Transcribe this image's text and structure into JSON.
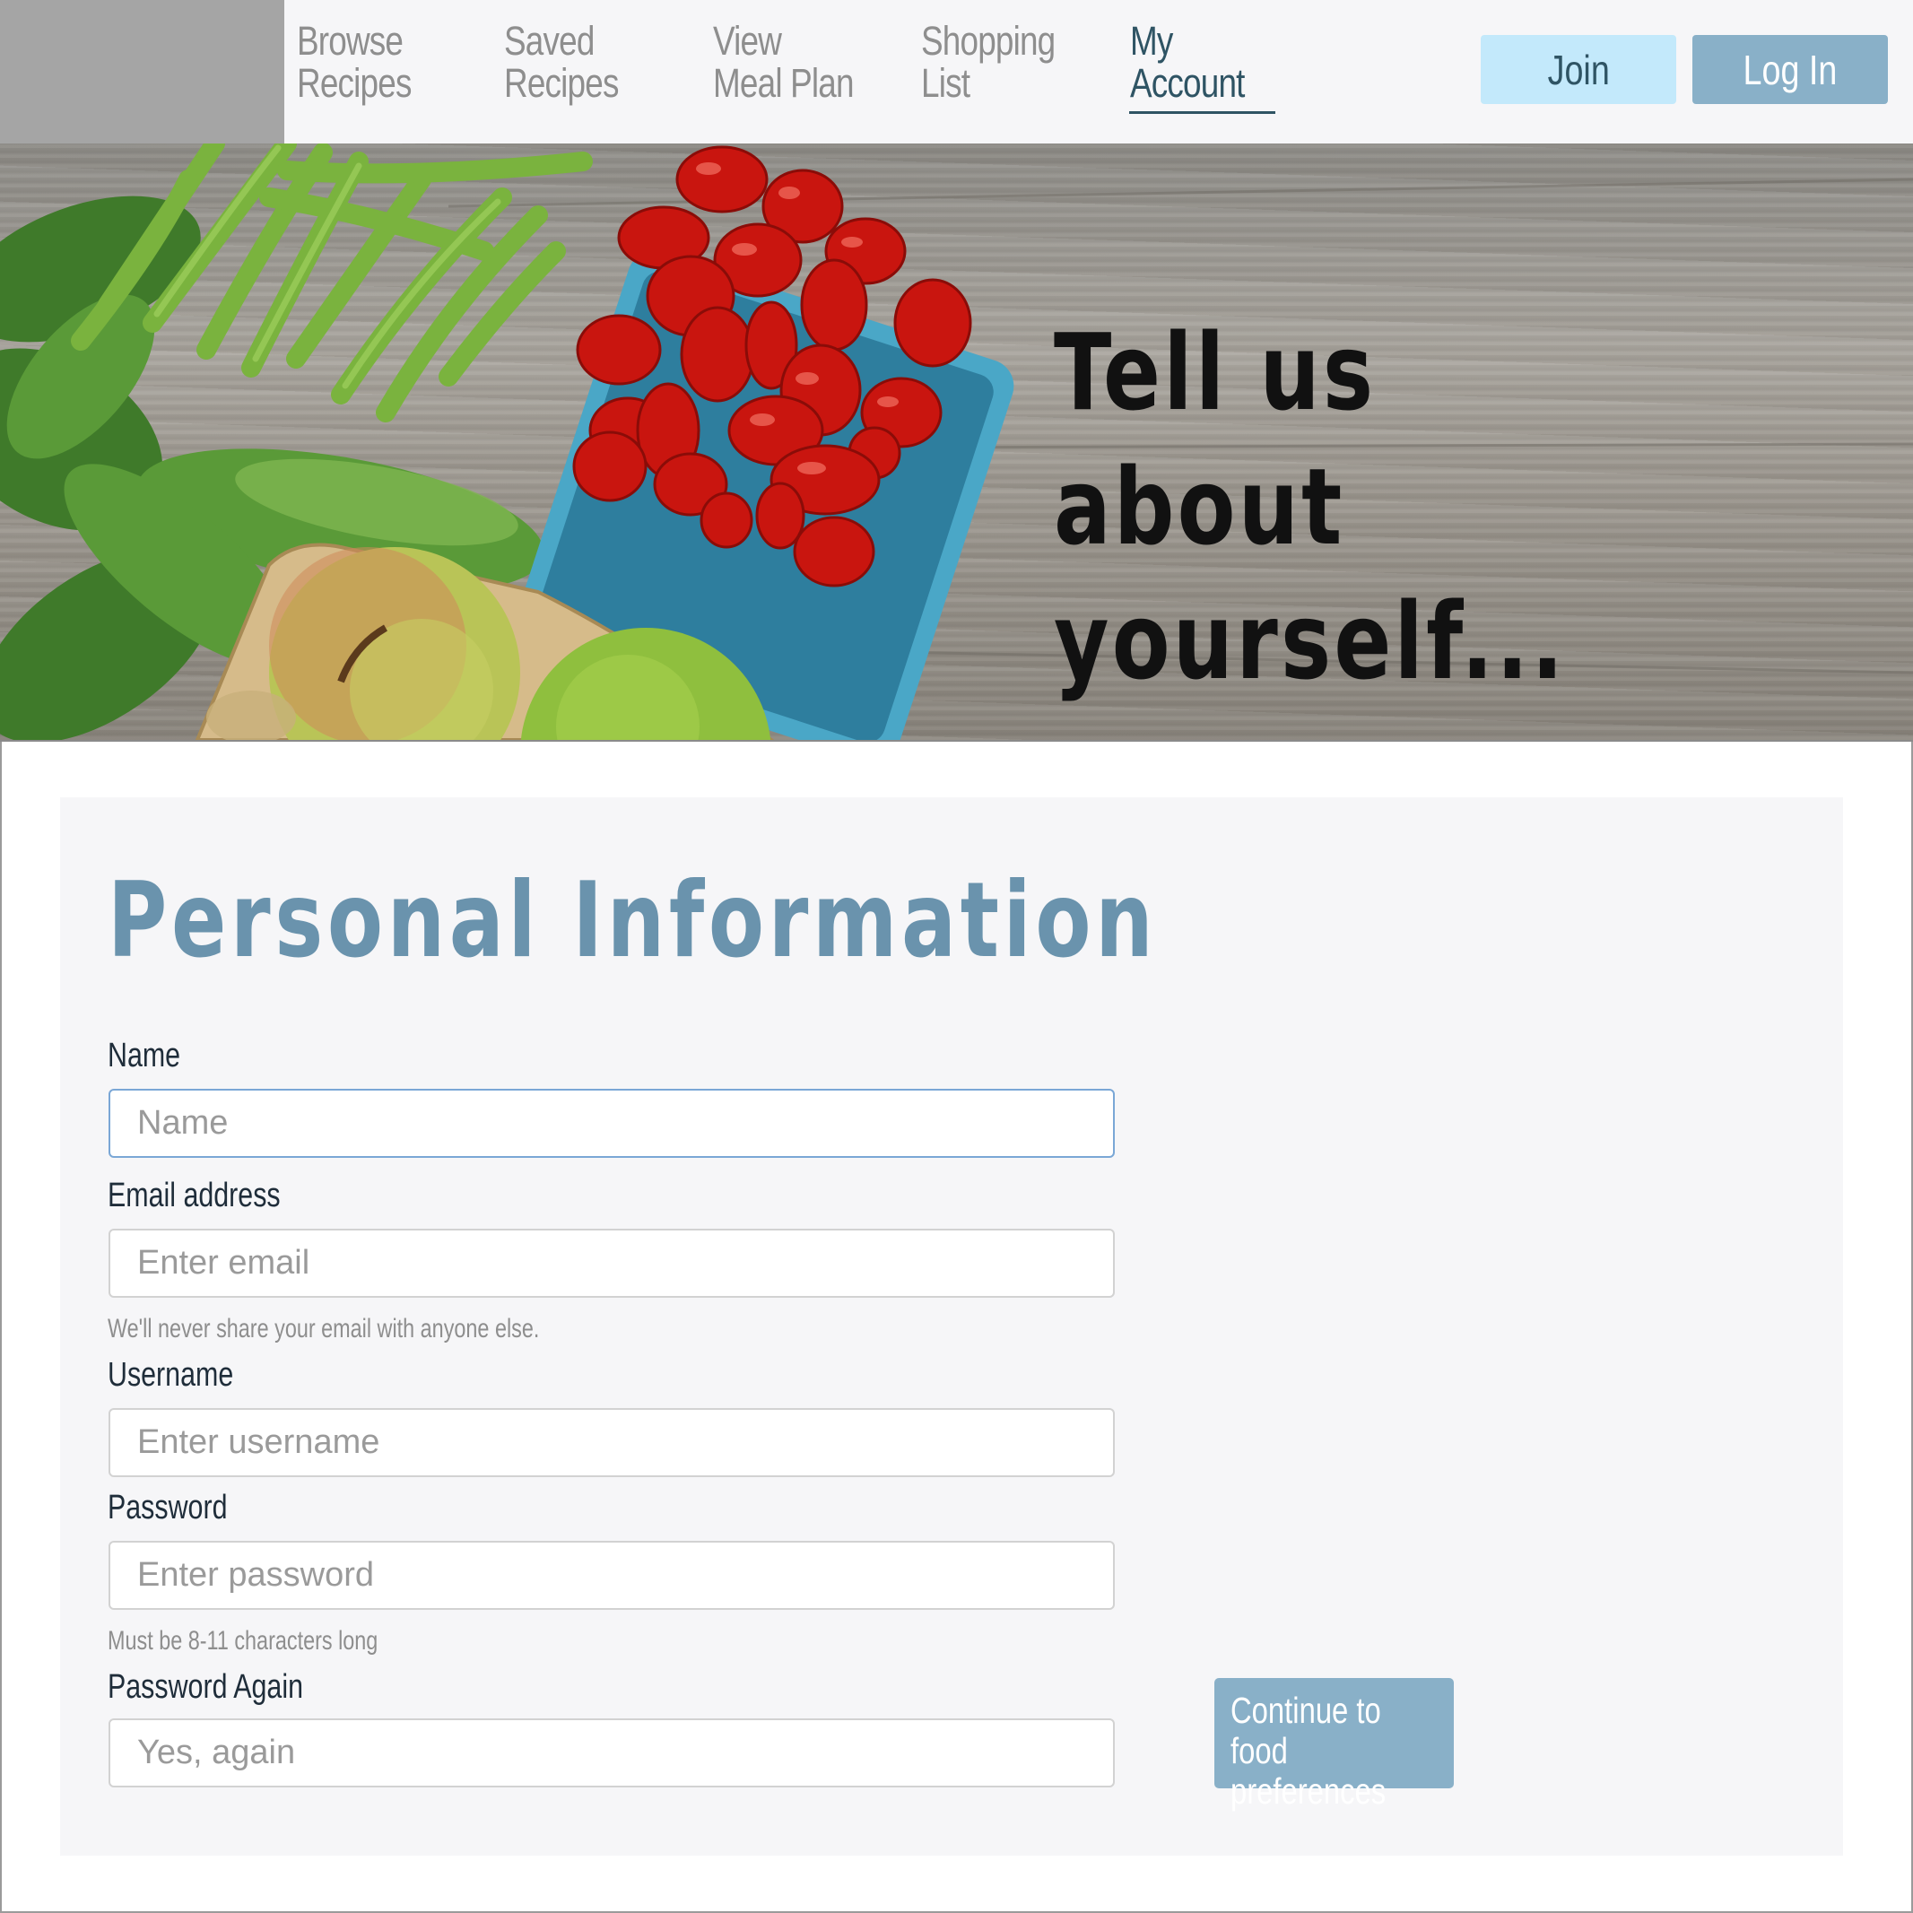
{
  "nav": {
    "items": [
      {
        "label": "Browse\nRecipes",
        "active": false
      },
      {
        "label": "Saved\nRecipes",
        "active": false
      },
      {
        "label": "View\nMeal Plan",
        "active": false
      },
      {
        "label": "Shopping\nList",
        "active": false
      },
      {
        "label": "My\nAccount",
        "active": true
      }
    ],
    "join_label": "Join",
    "login_label": "Log In"
  },
  "hero": {
    "title": "Tell us about yourself..."
  },
  "form": {
    "title": "Personal Information",
    "name_label": "Name",
    "name_placeholder": "Name",
    "email_label": "Email address",
    "email_placeholder": "Enter email",
    "email_help": "We'll never share your email with anyone else.",
    "username_label": "Username",
    "username_placeholder": "Enter username",
    "password_label": "Password",
    "password_placeholder": "Enter password",
    "password_help": "Must be 8-11 characters long",
    "password_again_label": "Password Again",
    "password_again_placeholder": "Yes, again",
    "continue_label": "Continue to food\npreferences"
  },
  "colors": {
    "accent": "#6a93ad",
    "button_join": "#c3e9fb",
    "button_login": "#89b0c8",
    "active_nav": "#2f5464"
  }
}
